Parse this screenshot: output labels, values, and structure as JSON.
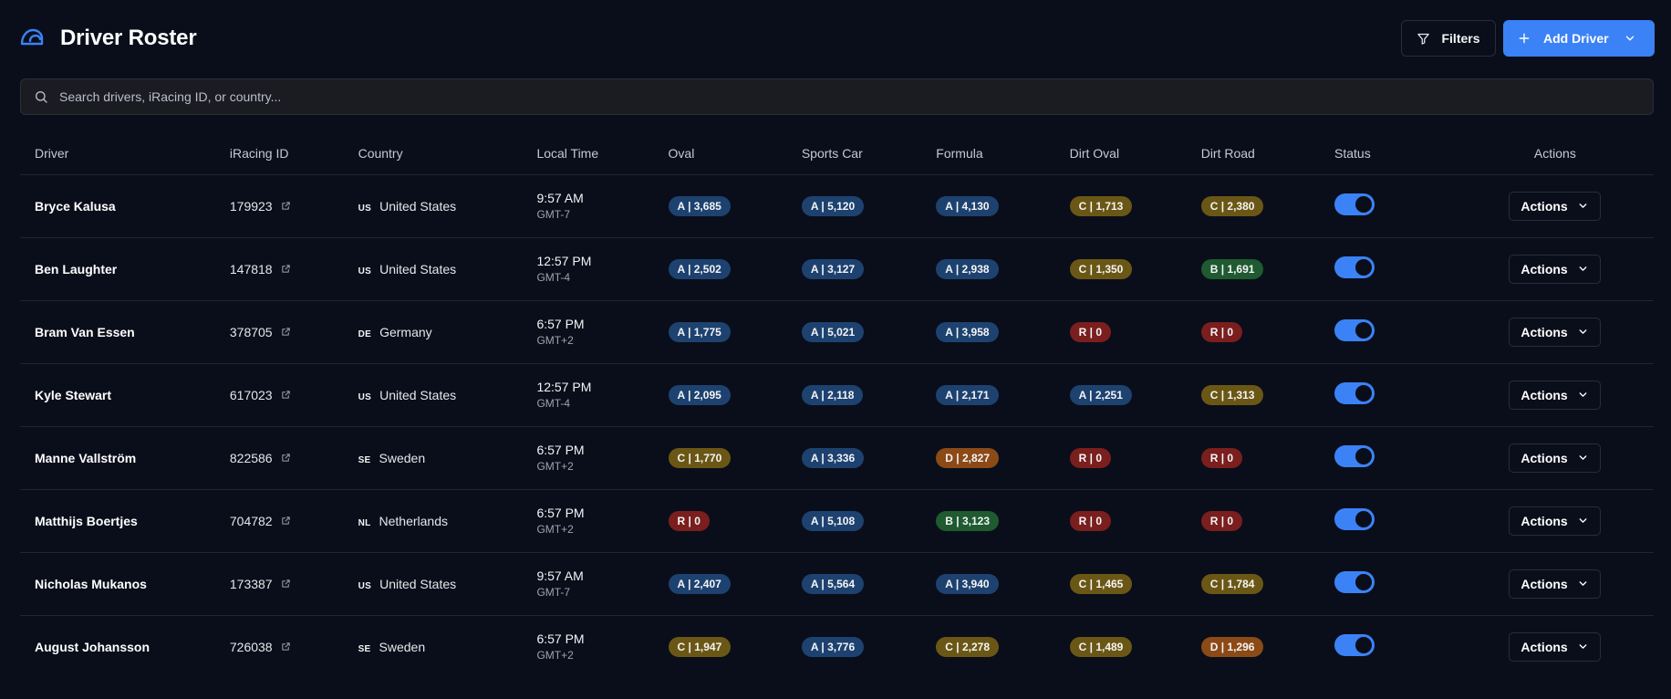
{
  "header": {
    "title": "Driver Roster",
    "filters_label": "Filters",
    "add_label": "Add Driver"
  },
  "search": {
    "placeholder": "Search drivers, iRacing ID, or country...",
    "value": ""
  },
  "table": {
    "columns": [
      "Driver",
      "iRacing ID",
      "Country",
      "Local Time",
      "Oval",
      "Sports Car",
      "Formula",
      "Dirt Oval",
      "Dirt Road",
      "Status",
      "Actions"
    ],
    "action_label": "Actions",
    "rows": [
      {
        "name": "Bryce Kalusa",
        "id": "179923",
        "cc": "US",
        "country": "United States",
        "time": "9:57 AM",
        "tz": "GMT-7",
        "licenses": [
          "A | 3,685",
          "A | 5,120",
          "A | 4,130",
          "C | 1,713",
          "C | 2,380"
        ],
        "status_on": true
      },
      {
        "name": "Ben Laughter",
        "id": "147818",
        "cc": "US",
        "country": "United States",
        "time": "12:57 PM",
        "tz": "GMT-4",
        "licenses": [
          "A | 2,502",
          "A | 3,127",
          "A | 2,938",
          "C | 1,350",
          "B | 1,691"
        ],
        "status_on": true
      },
      {
        "name": "Bram Van Essen",
        "id": "378705",
        "cc": "DE",
        "country": "Germany",
        "time": "6:57 PM",
        "tz": "GMT+2",
        "licenses": [
          "A | 1,775",
          "A | 5,021",
          "A | 3,958",
          "R | 0",
          "R | 0"
        ],
        "status_on": true
      },
      {
        "name": "Kyle Stewart",
        "id": "617023",
        "cc": "US",
        "country": "United States",
        "time": "12:57 PM",
        "tz": "GMT-4",
        "licenses": [
          "A | 2,095",
          "A | 2,118",
          "A | 2,171",
          "A | 2,251",
          "C | 1,313"
        ],
        "status_on": true
      },
      {
        "name": "Manne Vallström",
        "id": "822586",
        "cc": "SE",
        "country": "Sweden",
        "time": "6:57 PM",
        "tz": "GMT+2",
        "licenses": [
          "C | 1,770",
          "A | 3,336",
          "D | 2,827",
          "R | 0",
          "R | 0"
        ],
        "status_on": true
      },
      {
        "name": "Matthijs Boertjes",
        "id": "704782",
        "cc": "NL",
        "country": "Netherlands",
        "time": "6:57 PM",
        "tz": "GMT+2",
        "licenses": [
          "R | 0",
          "A | 5,108",
          "B | 3,123",
          "R | 0",
          "R | 0"
        ],
        "status_on": true
      },
      {
        "name": "Nicholas Mukanos",
        "id": "173387",
        "cc": "US",
        "country": "United States",
        "time": "9:57 AM",
        "tz": "GMT-7",
        "licenses": [
          "A | 2,407",
          "A | 5,564",
          "A | 3,940",
          "C | 1,465",
          "C | 1,784"
        ],
        "status_on": true
      },
      {
        "name": "August Johansson",
        "id": "726038",
        "cc": "SE",
        "country": "Sweden",
        "time": "6:57 PM",
        "tz": "GMT+2",
        "licenses": [
          "C | 1,947",
          "A | 3,776",
          "C | 2,278",
          "C | 1,489",
          "D | 1,296"
        ],
        "status_on": true
      }
    ]
  },
  "license_colors": {
    "A": "#1d4270",
    "B": "#1f5a30",
    "C": "#6b5715",
    "D": "#8c4a17",
    "R": "#7a1e1e"
  },
  "colors": {
    "accent": "#3b82f6",
    "background": "#0a0e1a"
  },
  "icons": {
    "logo": "helmet-icon",
    "filters": "filter-icon",
    "add": "plus-icon",
    "add_menu": "chevron-down-icon",
    "search": "search-icon",
    "external": "external-link-icon",
    "actions_menu": "chevron-down-icon"
  }
}
